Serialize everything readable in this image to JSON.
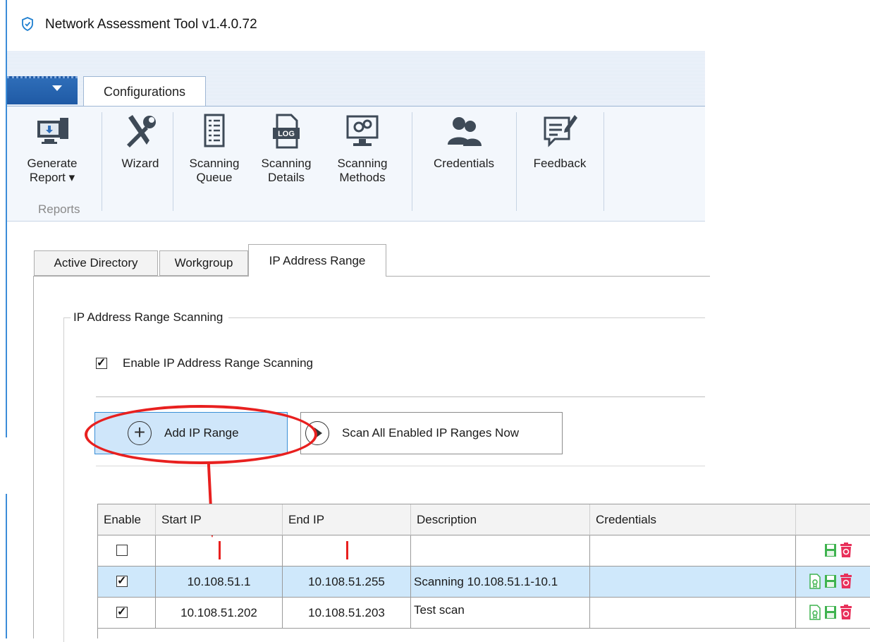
{
  "window": {
    "title": "Network Assessment Tool v1.4.0.72"
  },
  "ribbon": {
    "tab": "Configurations",
    "buttons": [
      {
        "label": "Generate",
        "label2": "Report ▾",
        "icon": "report-icon"
      },
      {
        "label": "Wizard",
        "icon": "tools-icon"
      },
      {
        "label": "Scanning",
        "label2": "Queue",
        "icon": "queue-icon"
      },
      {
        "label": "Scanning",
        "label2": "Details",
        "icon": "log-icon"
      },
      {
        "label": "Scanning",
        "label2": "Methods",
        "icon": "methods-icon"
      },
      {
        "label": "Credentials",
        "icon": "users-icon"
      },
      {
        "label": "Feedback",
        "icon": "feedback-icon"
      }
    ],
    "group_label": "Reports"
  },
  "tabs": [
    "Active Directory",
    "Workgroup",
    "IP Address Range"
  ],
  "groupbox": {
    "title": "IP Address Range Scanning",
    "enable_label": "Enable IP Address Range Scanning",
    "enable_checked": true
  },
  "buttons": {
    "add": "Add IP Range",
    "scan_all": "Scan All Enabled IP Ranges Now"
  },
  "table": {
    "headers": [
      "Enable",
      "Start IP",
      "End IP",
      "Description",
      "Credentials"
    ],
    "rows": [
      {
        "enabled": false,
        "start": "",
        "end": "",
        "description": "",
        "credentials": ""
      },
      {
        "enabled": true,
        "start": "10.108.51.1",
        "end": "10.108.51.255",
        "description": "Scanning 10.108.51.1-10.1",
        "credentials": ""
      },
      {
        "enabled": true,
        "start": "10.108.51.202",
        "end": "10.108.51.203",
        "description": "Test scan",
        "credentials": ""
      }
    ]
  },
  "colors": {
    "accent": "#2e6db8",
    "selection": "#cfe8fb",
    "annotation": "#e8201f",
    "save": "#3fb34f",
    "delete": "#e8305a"
  }
}
